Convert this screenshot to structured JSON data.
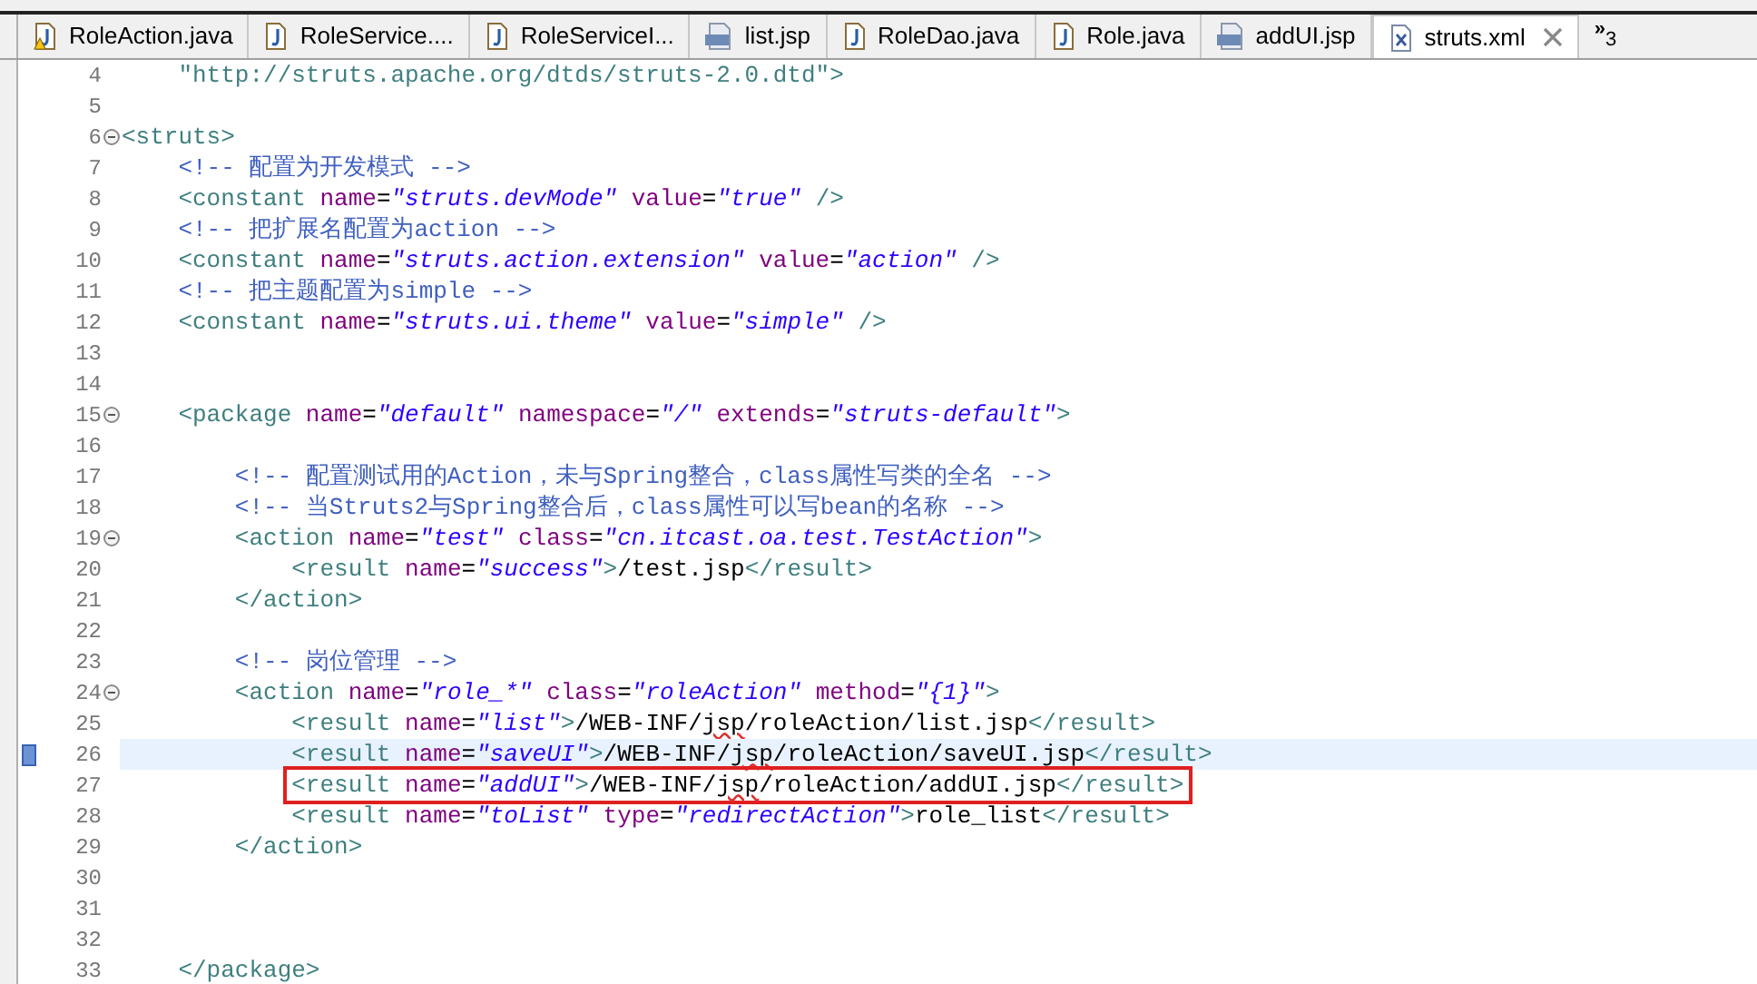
{
  "tabs": [
    {
      "label": "RoleAction.java",
      "kind": "java-warning",
      "selected": false
    },
    {
      "label": "RoleService....",
      "kind": "java",
      "selected": false
    },
    {
      "label": "RoleServiceI...",
      "kind": "java",
      "selected": false
    },
    {
      "label": "list.jsp",
      "kind": "jsp",
      "selected": false
    },
    {
      "label": "RoleDao.java",
      "kind": "java",
      "selected": false
    },
    {
      "label": "Role.java",
      "kind": "java",
      "selected": false
    },
    {
      "label": "addUI.jsp",
      "kind": "jsp",
      "selected": false
    },
    {
      "label": "struts.xml",
      "kind": "xml",
      "selected": true
    }
  ],
  "overflow": {
    "symbol": "»",
    "count": "3"
  },
  "lines": [
    {
      "number": "4",
      "fold": false,
      "current": false,
      "boxed": false,
      "tokens": [
        {
          "kind": "dtd",
          "text": "    \"http://struts.apache.org/dtds/struts-2.0.dtd\""
        },
        {
          "kind": "tag",
          "text": ">"
        }
      ]
    },
    {
      "number": "5",
      "fold": false,
      "current": false,
      "boxed": false
    },
    {
      "number": "6",
      "fold": true,
      "current": false,
      "boxed": false,
      "tokens": [
        {
          "kind": "tag",
          "text": "<struts>"
        }
      ]
    },
    {
      "number": "7",
      "fold": false,
      "current": false,
      "boxed": false,
      "tokens": [
        {
          "kind": "comment",
          "text": "    <!-- 配置为开发模式 -->"
        }
      ]
    },
    {
      "number": "8",
      "fold": false,
      "current": false,
      "boxed": false,
      "tokens": [
        {
          "kind": "tag",
          "text": "    <constant"
        },
        {
          "kind": "attr",
          "text": " name"
        },
        {
          "kind": "text",
          "text": "="
        },
        {
          "kind": "value",
          "text": "\"struts.devMode\""
        },
        {
          "kind": "attr",
          "text": " value"
        },
        {
          "kind": "text",
          "text": "="
        },
        {
          "kind": "value",
          "text": "\"true\""
        },
        {
          "kind": "tag",
          "text": " />"
        }
      ]
    },
    {
      "number": "9",
      "fold": false,
      "current": false,
      "boxed": false,
      "tokens": [
        {
          "kind": "comment",
          "text": "    <!-- 把扩展名配置为action -->"
        }
      ]
    },
    {
      "number": "10",
      "fold": false,
      "current": false,
      "boxed": false,
      "tokens": [
        {
          "kind": "tag",
          "text": "    <constant"
        },
        {
          "kind": "attr",
          "text": " name"
        },
        {
          "kind": "text",
          "text": "="
        },
        {
          "kind": "value",
          "text": "\"struts.action.extension\""
        },
        {
          "kind": "attr",
          "text": " value"
        },
        {
          "kind": "text",
          "text": "="
        },
        {
          "kind": "value",
          "text": "\"action\""
        },
        {
          "kind": "tag",
          "text": " />"
        }
      ]
    },
    {
      "number": "11",
      "fold": false,
      "current": false,
      "boxed": false,
      "tokens": [
        {
          "kind": "comment",
          "text": "    <!-- 把主题配置为simple -->"
        }
      ]
    },
    {
      "number": "12",
      "fold": false,
      "current": false,
      "boxed": false,
      "tokens": [
        {
          "kind": "tag",
          "text": "    <constant"
        },
        {
          "kind": "attr",
          "text": " name"
        },
        {
          "kind": "text",
          "text": "="
        },
        {
          "kind": "value",
          "text": "\"struts.ui.theme\""
        },
        {
          "kind": "attr",
          "text": " value"
        },
        {
          "kind": "text",
          "text": "="
        },
        {
          "kind": "value",
          "text": "\"simple\""
        },
        {
          "kind": "tag",
          "text": " />"
        }
      ]
    },
    {
      "number": "13",
      "fold": false,
      "current": false,
      "boxed": false
    },
    {
      "number": "14",
      "fold": false,
      "current": false,
      "boxed": false
    },
    {
      "number": "15",
      "fold": true,
      "current": false,
      "boxed": false,
      "tokens": [
        {
          "kind": "tag",
          "text": "    <package"
        },
        {
          "kind": "attr",
          "text": " name"
        },
        {
          "kind": "text",
          "text": "="
        },
        {
          "kind": "value",
          "text": "\"default\""
        },
        {
          "kind": "attr",
          "text": " namespace"
        },
        {
          "kind": "text",
          "text": "="
        },
        {
          "kind": "value",
          "text": "\"/\""
        },
        {
          "kind": "attr",
          "text": " extends"
        },
        {
          "kind": "text",
          "text": "="
        },
        {
          "kind": "value",
          "text": "\"struts-default\""
        },
        {
          "kind": "tag",
          "text": ">"
        }
      ]
    },
    {
      "number": "16",
      "fold": false,
      "current": false,
      "boxed": false
    },
    {
      "number": "17",
      "fold": false,
      "current": false,
      "boxed": false,
      "tokens": [
        {
          "kind": "comment",
          "text": "        <!-- 配置测试用的Action，未与Spring整合，class属性写类的全名 -->"
        }
      ]
    },
    {
      "number": "18",
      "fold": false,
      "current": false,
      "boxed": false,
      "tokens": [
        {
          "kind": "comment",
          "text": "        <!-- 当Struts2与Spring整合后，class属性可以写bean的名称 -->"
        }
      ]
    },
    {
      "number": "19",
      "fold": true,
      "current": false,
      "boxed": false,
      "tokens": [
        {
          "kind": "tag",
          "text": "        <action"
        },
        {
          "kind": "attr",
          "text": " name"
        },
        {
          "kind": "text",
          "text": "="
        },
        {
          "kind": "value",
          "text": "\"test\""
        },
        {
          "kind": "attr",
          "text": " class"
        },
        {
          "kind": "text",
          "text": "="
        },
        {
          "kind": "value",
          "text": "\"cn.itcast.oa.test.TestAction\""
        },
        {
          "kind": "tag",
          "text": ">"
        }
      ]
    },
    {
      "number": "20",
      "fold": false,
      "current": false,
      "boxed": false,
      "tokens": [
        {
          "kind": "tag",
          "text": "            <result"
        },
        {
          "kind": "attr",
          "text": " name"
        },
        {
          "kind": "text",
          "text": "="
        },
        {
          "kind": "value",
          "text": "\"success\""
        },
        {
          "kind": "tag",
          "text": ">"
        },
        {
          "kind": "text",
          "text": "/test.jsp"
        },
        {
          "kind": "tag",
          "text": "</result>"
        }
      ]
    },
    {
      "number": "21",
      "fold": false,
      "current": false,
      "boxed": false,
      "tokens": [
        {
          "kind": "tag",
          "text": "        </action>"
        }
      ]
    },
    {
      "number": "22",
      "fold": false,
      "current": false,
      "boxed": false
    },
    {
      "number": "23",
      "fold": false,
      "current": false,
      "boxed": false,
      "tokens": [
        {
          "kind": "comment",
          "text": "        <!-- 岗位管理 -->"
        }
      ]
    },
    {
      "number": "24",
      "fold": true,
      "current": false,
      "boxed": false,
      "tokens": [
        {
          "kind": "tag",
          "text": "        <action"
        },
        {
          "kind": "attr",
          "text": " name"
        },
        {
          "kind": "text",
          "text": "="
        },
        {
          "kind": "value",
          "text": "\"role_*\""
        },
        {
          "kind": "attr",
          "text": " class"
        },
        {
          "kind": "text",
          "text": "="
        },
        {
          "kind": "value",
          "text": "\"roleAction\""
        },
        {
          "kind": "attr",
          "text": " method"
        },
        {
          "kind": "text",
          "text": "="
        },
        {
          "kind": "value",
          "text": "\"{1}\""
        },
        {
          "kind": "tag",
          "text": ">"
        }
      ]
    },
    {
      "number": "25",
      "fold": false,
      "current": false,
      "boxed": false,
      "tokens": [
        {
          "kind": "tag",
          "text": "            <result"
        },
        {
          "kind": "attr",
          "text": " name"
        },
        {
          "kind": "text",
          "text": "="
        },
        {
          "kind": "value",
          "text": "\"list\""
        },
        {
          "kind": "tag",
          "text": ">"
        },
        {
          "kind": "text",
          "text": "/WEB-INF/"
        },
        {
          "kind": "misspelled",
          "text": "jsp"
        },
        {
          "kind": "text",
          "text": "/roleAction/list.jsp"
        },
        {
          "kind": "tag",
          "text": "</result>"
        }
      ]
    },
    {
      "number": "26",
      "fold": false,
      "current": true,
      "boxed": false,
      "tokens": [
        {
          "kind": "tag",
          "text": "            <result"
        },
        {
          "kind": "attr",
          "text": " name"
        },
        {
          "kind": "text",
          "text": "="
        },
        {
          "kind": "value",
          "text": "\"saveUI\""
        },
        {
          "kind": "tag",
          "text": ">"
        },
        {
          "kind": "text",
          "text": "/WEB-INF/"
        },
        {
          "kind": "misspelled",
          "text": "jsp"
        },
        {
          "kind": "text",
          "text": "/roleAction/saveUI.jsp"
        },
        {
          "kind": "tag",
          "text": "</result>"
        }
      ]
    },
    {
      "number": "27",
      "fold": false,
      "current": false,
      "boxed": true,
      "tokens": [
        {
          "kind": "tag",
          "text": "            <result"
        },
        {
          "kind": "attr",
          "text": " name"
        },
        {
          "kind": "text",
          "text": "="
        },
        {
          "kind": "value",
          "text": "\"addUI\""
        },
        {
          "kind": "tag",
          "text": ">"
        },
        {
          "kind": "text",
          "text": "/WEB-INF/"
        },
        {
          "kind": "misspelled",
          "text": "jsp"
        },
        {
          "kind": "text",
          "text": "/roleAction/addUI.jsp"
        },
        {
          "kind": "tag",
          "text": "</result>"
        }
      ]
    },
    {
      "number": "28",
      "fold": false,
      "current": false,
      "boxed": false,
      "tokens": [
        {
          "kind": "tag",
          "text": "            <result"
        },
        {
          "kind": "attr",
          "text": " name"
        },
        {
          "kind": "text",
          "text": "="
        },
        {
          "kind": "value",
          "text": "\"toList\""
        },
        {
          "kind": "attr",
          "text": " type"
        },
        {
          "kind": "text",
          "text": "="
        },
        {
          "kind": "value",
          "text": "\"redirectAction\""
        },
        {
          "kind": "tag",
          "text": ">"
        },
        {
          "kind": "text",
          "text": "role_list"
        },
        {
          "kind": "tag",
          "text": "</result>"
        }
      ]
    },
    {
      "number": "29",
      "fold": false,
      "current": false,
      "boxed": false,
      "tokens": [
        {
          "kind": "tag",
          "text": "        </action>"
        }
      ]
    },
    {
      "number": "30",
      "fold": false,
      "current": false,
      "boxed": false
    },
    {
      "number": "31",
      "fold": false,
      "current": false,
      "boxed": false
    },
    {
      "number": "32",
      "fold": false,
      "current": false,
      "boxed": false
    },
    {
      "number": "33",
      "fold": false,
      "current": false,
      "boxed": false,
      "tokens": [
        {
          "kind": "tag",
          "text": "    </package>"
        }
      ]
    }
  ]
}
